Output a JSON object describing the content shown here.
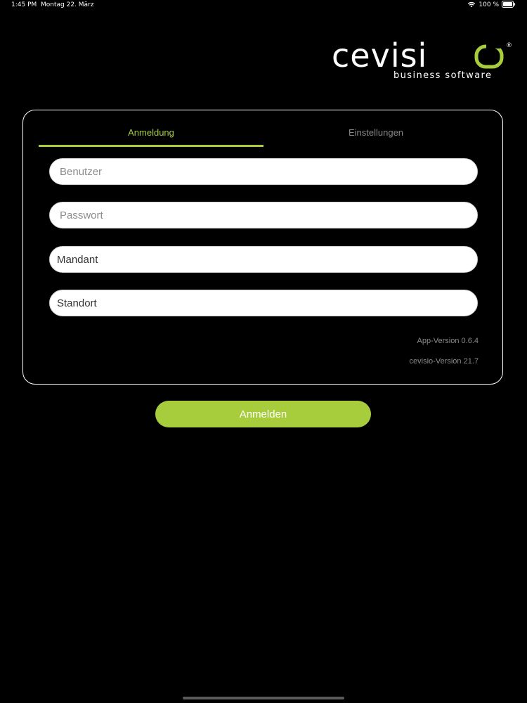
{
  "status_bar": {
    "time": "1:45 PM",
    "date": "Montag 22. März",
    "battery_text": "100 %"
  },
  "logo": {
    "brand_name": "cevisio",
    "tagline": "business software",
    "registered_mark": "®"
  },
  "tabs": {
    "login_label": "Anmeldung",
    "settings_label": "Einstellungen"
  },
  "form": {
    "user_placeholder": "Benutzer",
    "password_placeholder": "Passwort",
    "client_value": "Mandant",
    "location_value": "Standort"
  },
  "versions": {
    "app_version": "App-Version 0.6.4",
    "cevisio_version": "cevisio-Version 21.7"
  },
  "actions": {
    "login_label": "Anmelden"
  },
  "colors": {
    "accent": "#a8cd3c",
    "background": "#000000",
    "muted_text": "#8a8a8a"
  }
}
